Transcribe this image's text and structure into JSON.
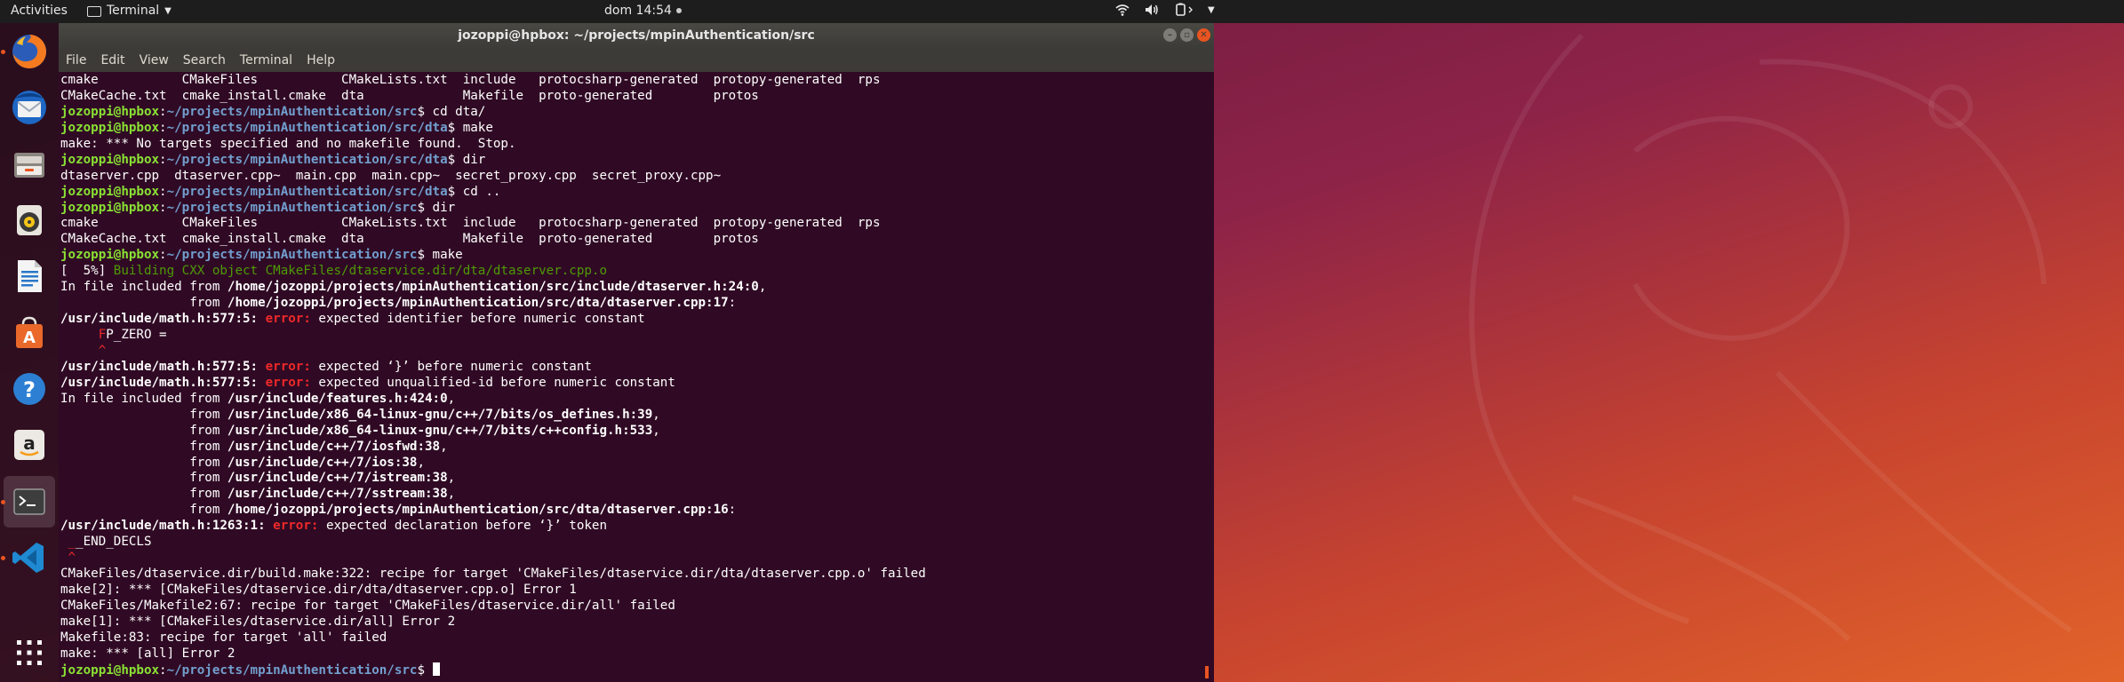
{
  "topbar": {
    "activities": "Activities",
    "app_name": "Terminal",
    "clock": "dom 14:54"
  },
  "dock": {
    "items": [
      {
        "name": "firefox-icon",
        "running": true
      },
      {
        "name": "thunderbird-icon",
        "running": false
      },
      {
        "name": "files-icon",
        "running": false
      },
      {
        "name": "rhythmbox-icon",
        "running": false
      },
      {
        "name": "writer-icon",
        "running": false
      },
      {
        "name": "software-icon",
        "running": false
      },
      {
        "name": "help-icon",
        "running": false
      },
      {
        "name": "amazon-icon",
        "running": false
      },
      {
        "name": "terminal-icon",
        "running": true
      },
      {
        "name": "vscode-icon",
        "running": true
      }
    ],
    "show_apps_icon": "apps-grid-icon"
  },
  "window": {
    "title": "jozoppi@hpbox: ~/projects/mpinAuthentication/src",
    "menu": [
      "File",
      "Edit",
      "View",
      "Search",
      "Terminal",
      "Help"
    ]
  },
  "colors": {
    "terminal_bg": "#300a24",
    "prompt_user": "#8ae234",
    "prompt_path": "#729fcf",
    "error": "#ef2929",
    "build_green": "#4e9a06",
    "accent": "#e95420"
  },
  "terminal": {
    "lines": [
      [
        {
          "t": "cmake           CMakeFiles           CMakeLists.txt  include   protocsharp-generated  protopy-generated  rps"
        }
      ],
      [
        {
          "t": "CMakeCache.txt  cmake_install.cmake  dta             Makefile  proto-generated        protos"
        }
      ],
      [
        {
          "t": "jozoppi@hpbox",
          "c": "prompt"
        },
        {
          "t": ":"
        },
        {
          "t": "~/projects/mpinAuthentication/src",
          "c": "path"
        },
        {
          "t": "$ cd dta/"
        }
      ],
      [
        {
          "t": "jozoppi@hpbox",
          "c": "prompt"
        },
        {
          "t": ":"
        },
        {
          "t": "~/projects/mpinAuthentication/src/dta",
          "c": "path"
        },
        {
          "t": "$ make"
        }
      ],
      [
        {
          "t": "make: *** No targets specified and no makefile found.  Stop."
        }
      ],
      [
        {
          "t": "jozoppi@hpbox",
          "c": "prompt"
        },
        {
          "t": ":"
        },
        {
          "t": "~/projects/mpinAuthentication/src/dta",
          "c": "path"
        },
        {
          "t": "$ dir"
        }
      ],
      [
        {
          "t": "dtaserver.cpp  dtaserver.cpp~  main.cpp  main.cpp~  secret_proxy.cpp  secret_proxy.cpp~"
        }
      ],
      [
        {
          "t": "jozoppi@hpbox",
          "c": "prompt"
        },
        {
          "t": ":"
        },
        {
          "t": "~/projects/mpinAuthentication/src/dta",
          "c": "path"
        },
        {
          "t": "$ cd .."
        }
      ],
      [
        {
          "t": "jozoppi@hpbox",
          "c": "prompt"
        },
        {
          "t": ":"
        },
        {
          "t": "~/projects/mpinAuthentication/src",
          "c": "path"
        },
        {
          "t": "$ dir"
        }
      ],
      [
        {
          "t": "cmake           CMakeFiles           CMakeLists.txt  include   protocsharp-generated  protopy-generated  rps"
        }
      ],
      [
        {
          "t": "CMakeCache.txt  cmake_install.cmake  dta             Makefile  proto-generated        protos"
        }
      ],
      [
        {
          "t": "jozoppi@hpbox",
          "c": "prompt"
        },
        {
          "t": ":"
        },
        {
          "t": "~/projects/mpinAuthentication/src",
          "c": "path"
        },
        {
          "t": "$ make"
        }
      ],
      [
        {
          "t": "[  5%] "
        },
        {
          "t": "Building CXX object CMakeFiles/dtaservice.dir/dta/dtaserver.cpp.o",
          "c": "green"
        }
      ],
      [
        {
          "t": "In file included from "
        },
        {
          "t": "/home/jozoppi/projects/mpinAuthentication/src/include/dtaserver.h:24:0",
          "c": "bold"
        },
        {
          "t": ","
        }
      ],
      [
        {
          "t": "                 from "
        },
        {
          "t": "/home/jozoppi/projects/mpinAuthentication/src/dta/dtaserver.cpp:17",
          "c": "bold"
        },
        {
          "t": ":"
        }
      ],
      [
        {
          "t": "/usr/include/math.h:577:5:",
          "c": "bold"
        },
        {
          "t": " "
        },
        {
          "t": "error:",
          "c": "error"
        },
        {
          "t": " expected identifier before numeric constant"
        }
      ],
      [
        {
          "t": "     "
        },
        {
          "t": "F",
          "c": "red"
        },
        {
          "t": "P_ZERO ="
        }
      ],
      [
        {
          "t": "     "
        },
        {
          "t": "^",
          "c": "red"
        }
      ],
      [
        {
          "t": "/usr/include/math.h:577:5:",
          "c": "bold"
        },
        {
          "t": " "
        },
        {
          "t": "error:",
          "c": "error"
        },
        {
          "t": " expected ‘}’ before numeric constant"
        }
      ],
      [
        {
          "t": "/usr/include/math.h:577:5:",
          "c": "bold"
        },
        {
          "t": " "
        },
        {
          "t": "error:",
          "c": "error"
        },
        {
          "t": " expected unqualified-id before numeric constant"
        }
      ],
      [
        {
          "t": "In file included from "
        },
        {
          "t": "/usr/include/features.h:424:0",
          "c": "bold"
        },
        {
          "t": ","
        }
      ],
      [
        {
          "t": "                 from "
        },
        {
          "t": "/usr/include/x86_64-linux-gnu/c++/7/bits/os_defines.h:39",
          "c": "bold"
        },
        {
          "t": ","
        }
      ],
      [
        {
          "t": "                 from "
        },
        {
          "t": "/usr/include/x86_64-linux-gnu/c++/7/bits/c++config.h:533",
          "c": "bold"
        },
        {
          "t": ","
        }
      ],
      [
        {
          "t": "                 from "
        },
        {
          "t": "/usr/include/c++/7/iosfwd:38",
          "c": "bold"
        },
        {
          "t": ","
        }
      ],
      [
        {
          "t": "                 from "
        },
        {
          "t": "/usr/include/c++/7/ios:38",
          "c": "bold"
        },
        {
          "t": ","
        }
      ],
      [
        {
          "t": "                 from "
        },
        {
          "t": "/usr/include/c++/7/istream:38",
          "c": "bold"
        },
        {
          "t": ","
        }
      ],
      [
        {
          "t": "                 from "
        },
        {
          "t": "/usr/include/c++/7/sstream:38",
          "c": "bold"
        },
        {
          "t": ","
        }
      ],
      [
        {
          "t": "                 from "
        },
        {
          "t": "/home/jozoppi/projects/mpinAuthentication/src/dta/dtaserver.cpp:16",
          "c": "bold"
        },
        {
          "t": ":"
        }
      ],
      [
        {
          "t": "/usr/include/math.h:1263:1:",
          "c": "bold"
        },
        {
          "t": " "
        },
        {
          "t": "error:",
          "c": "error"
        },
        {
          "t": " expected declaration before ‘}’ token"
        }
      ],
      [
        {
          "t": " "
        },
        {
          "t": "_",
          "c": "red"
        },
        {
          "t": "_END_DECLS"
        }
      ],
      [
        {
          "t": " "
        },
        {
          "t": "^",
          "c": "red"
        }
      ],
      [
        {
          "t": "CMakeFiles/dtaservice.dir/build.make:322: recipe for target 'CMakeFiles/dtaservice.dir/dta/dtaserver.cpp.o' failed"
        }
      ],
      [
        {
          "t": "make[2]: *** [CMakeFiles/dtaservice.dir/dta/dtaserver.cpp.o] Error 1"
        }
      ],
      [
        {
          "t": "CMakeFiles/Makefile2:67: recipe for target 'CMakeFiles/dtaservice.dir/all' failed"
        }
      ],
      [
        {
          "t": "make[1]: *** [CMakeFiles/dtaservice.dir/all] Error 2"
        }
      ],
      [
        {
          "t": "Makefile:83: recipe for target 'all' failed"
        }
      ],
      [
        {
          "t": "make: *** [all] Error 2"
        }
      ],
      [
        {
          "t": "jozoppi@hpbox",
          "c": "prompt"
        },
        {
          "t": ":"
        },
        {
          "t": "~/projects/mpinAuthentication/src",
          "c": "path"
        },
        {
          "t": "$ "
        },
        {
          "t": "",
          "c": "cursor"
        }
      ]
    ]
  }
}
